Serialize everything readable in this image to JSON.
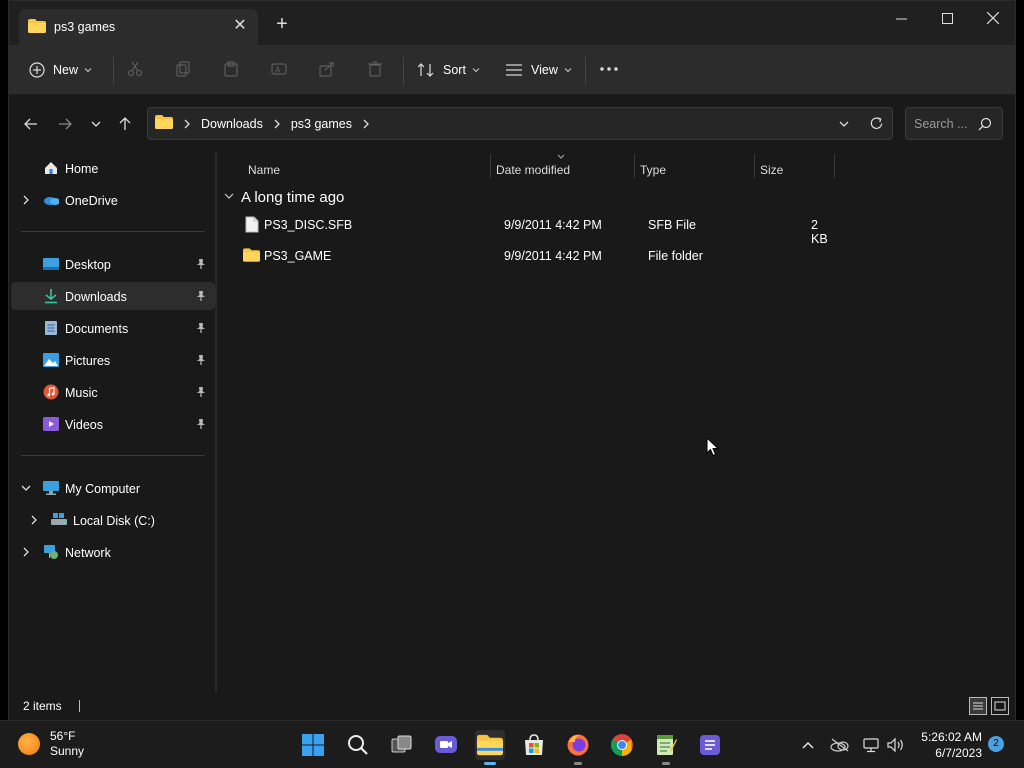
{
  "window": {
    "tab_title": "ps3 games"
  },
  "toolbar": {
    "new_label": "New",
    "sort_label": "Sort",
    "view_label": "View"
  },
  "address": {
    "crumbs": [
      "Downloads",
      "ps3 games"
    ],
    "search_placeholder": "Search ..."
  },
  "sidebar": {
    "items": [
      {
        "label": "Home",
        "icon": "home-icon"
      },
      {
        "label": "OneDrive",
        "icon": "onedrive-icon"
      },
      {
        "label": "Desktop",
        "icon": "desktop-icon",
        "pinned": true
      },
      {
        "label": "Downloads",
        "icon": "downloads-icon",
        "pinned": true,
        "selected": true
      },
      {
        "label": "Documents",
        "icon": "documents-icon",
        "pinned": true
      },
      {
        "label": "Pictures",
        "icon": "pictures-icon",
        "pinned": true
      },
      {
        "label": "Music",
        "icon": "music-icon",
        "pinned": true
      },
      {
        "label": "Videos",
        "icon": "videos-icon",
        "pinned": true
      },
      {
        "label": "My Computer",
        "icon": "computer-icon",
        "expanded": true
      },
      {
        "label": "Local Disk (C:)",
        "icon": "drive-icon"
      },
      {
        "label": "Network",
        "icon": "network-icon"
      }
    ]
  },
  "content": {
    "columns": [
      "Name",
      "Date modified",
      "Type",
      "Size"
    ],
    "group_label": "A long time ago",
    "files": [
      {
        "name": "PS3_DISC.SFB",
        "date": "9/9/2011 4:42 PM",
        "type": "SFB File",
        "size": "2 KB",
        "icon": "file-icon"
      },
      {
        "name": "PS3_GAME",
        "date": "9/9/2011 4:42 PM",
        "type": "File folder",
        "size": "",
        "icon": "folder-icon"
      }
    ]
  },
  "status": {
    "item_count": "2 items"
  },
  "taskbar": {
    "weather_temp": "56°F",
    "weather_desc": "Sunny",
    "time": "5:26:02 AM",
    "date": "6/7/2023",
    "notification_count": "2"
  },
  "colors": {
    "window_bg": "#191919",
    "toolbar_bg": "#2c2c2c",
    "accent": "#5fb2f2",
    "folder_yellow": "#f6c343"
  }
}
